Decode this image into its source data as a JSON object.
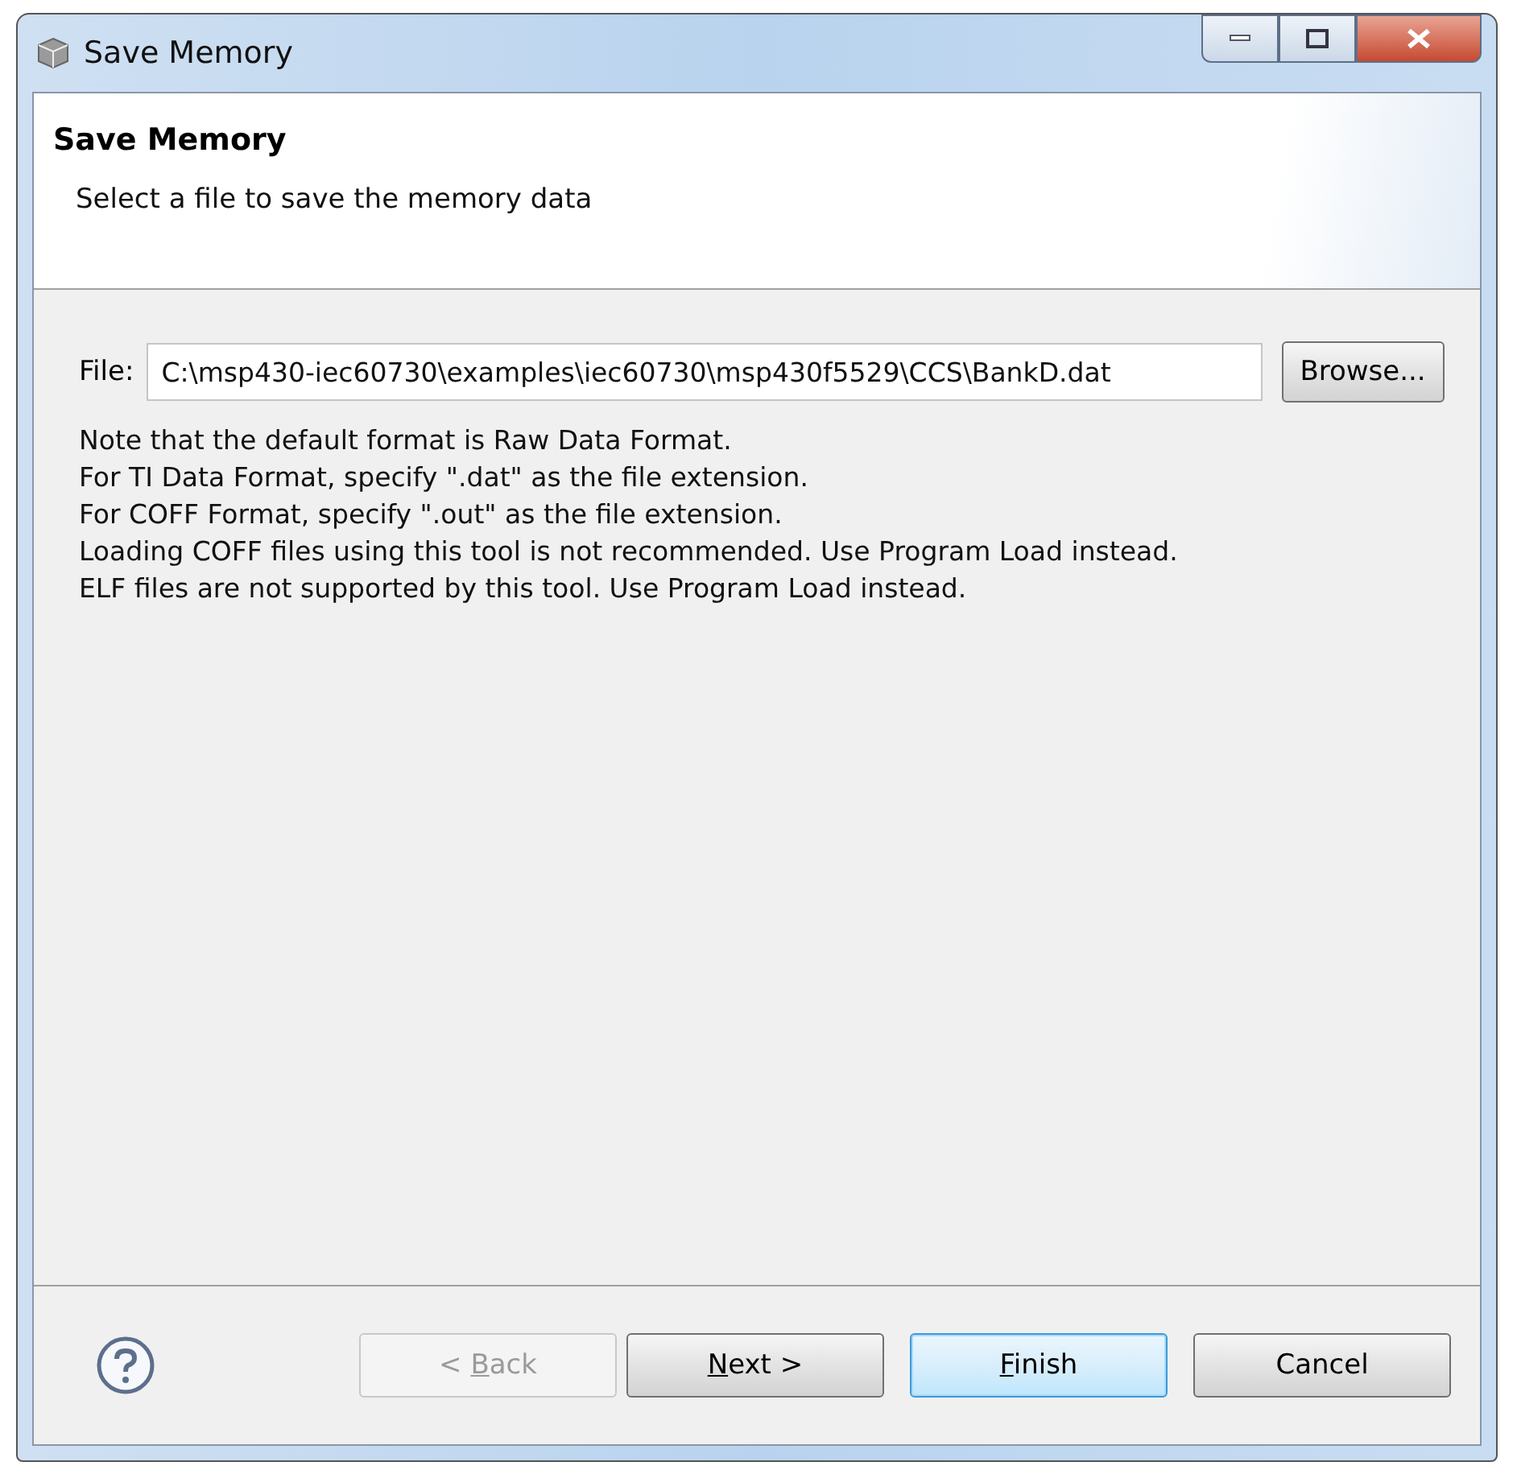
{
  "window": {
    "title": "Save Memory"
  },
  "header": {
    "title": "Save Memory",
    "description": "Select a file to save the memory data"
  },
  "file": {
    "label": "File:",
    "value": "C:\\msp430-iec60730\\examples\\iec60730\\msp430f5529\\CCS\\BankD.dat",
    "browse": "Browse..."
  },
  "notes": [
    "Note that the default format is Raw Data Format.",
    "For TI Data Format, specify \".dat\" as the file extension.",
    "For COFF Format, specify \".out\" as the file extension.",
    "Loading COFF files using this tool is not recommended. Use Program Load instead.",
    "ELF files are not supported by this tool. Use Program Load instead."
  ],
  "buttons": [
    {
      "before": "< ",
      "mnemonic": "B",
      "after": "ack",
      "disabled": true,
      "default": false
    },
    {
      "mnemonic": "N",
      "after": "ext >",
      "disabled": false,
      "default": false
    },
    {
      "mnemonic": "F",
      "after": "inish",
      "disabled": false,
      "default": true
    },
    {
      "before": "Cancel",
      "disabled": false,
      "default": false
    }
  ]
}
